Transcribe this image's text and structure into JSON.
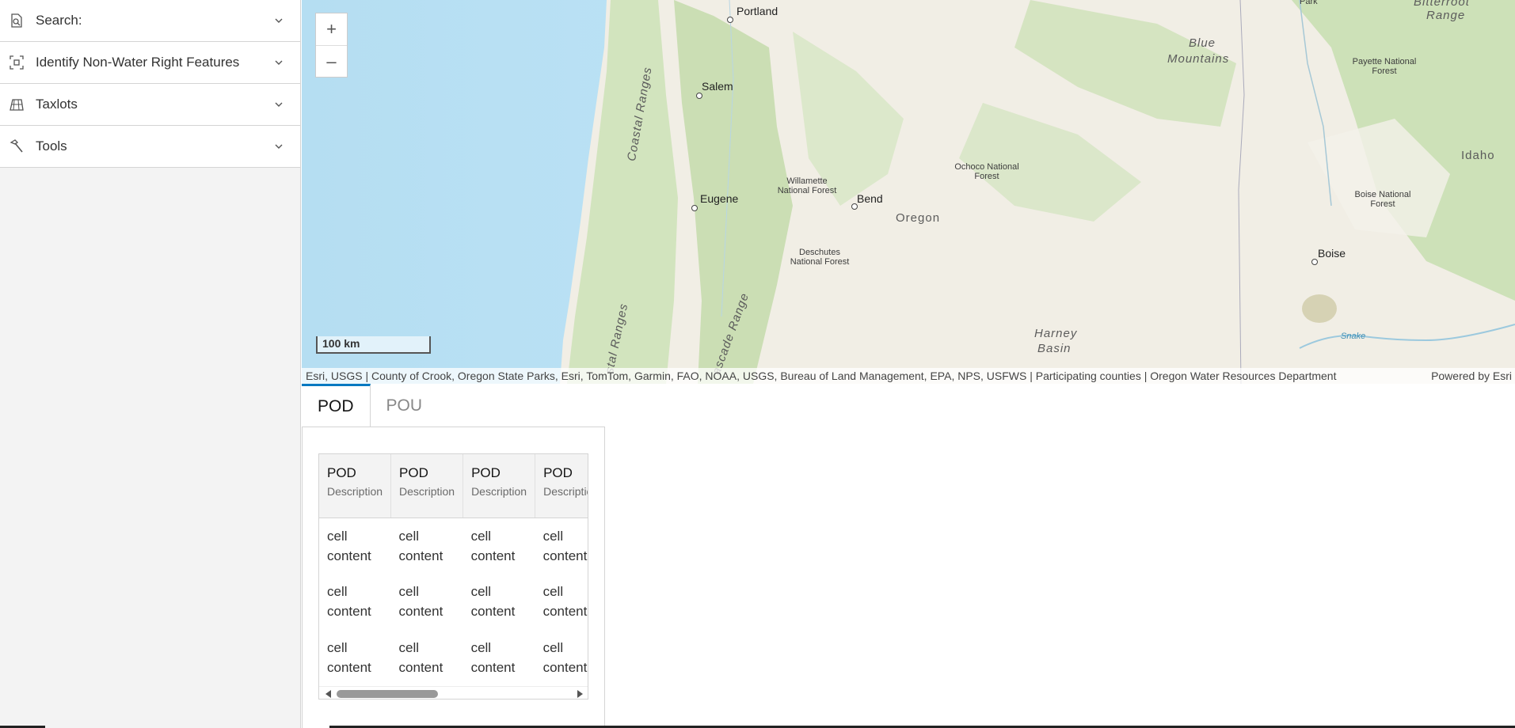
{
  "sidebar": {
    "items": [
      {
        "label": "Search:",
        "icon": "search-doc-icon"
      },
      {
        "label": "Identify Non-Water Right Features",
        "icon": "identify-select-icon"
      },
      {
        "label": "Taxlots",
        "icon": "taxlot-parcel-icon"
      },
      {
        "label": "Tools",
        "icon": "hammer-icon"
      }
    ]
  },
  "map": {
    "zoom_in": "+",
    "zoom_out": "–",
    "scale": "100 km",
    "labels": {
      "portland": "Portland",
      "salem": "Salem",
      "eugene": "Eugene",
      "bend": "Bend",
      "boise": "Boise",
      "oregon": "Oregon",
      "idaho": "Idaho",
      "coastal_ranges": "Coastal Ranges",
      "coastal_ranges_south": "stal Ranges",
      "cascade_range": "ascade Range",
      "blue_mountains_1": "Blue",
      "blue_mountains_2": "Mountains",
      "willamette_1": "Willamette",
      "willamette_2": "National Forest",
      "deschutes_1": "Deschutes",
      "deschutes_2": "National Forest",
      "ochoco_1": "Ochoco National",
      "ochoco_2": "Forest",
      "payette_1": "Payette National",
      "payette_2": "Forest",
      "boise_nf_1": "Boise National",
      "boise_nf_2": "Forest",
      "harney_1": "Harney",
      "harney_2": "Basin",
      "bitterroot_1": "Bitterroot",
      "bitterroot_2": "Range",
      "park": "Park",
      "snake": "Snake"
    },
    "attribution": "Esri, USGS | County of Crook, Oregon State Parks, Esri, TomTom, Garmin, FAO, NOAA, USGS, Bureau of Land Management, EPA, NPS, USFWS | Participating counties | Oregon Water Resources Department",
    "powered_by": "Powered by Esri",
    "widgets": [
      "legend-list-icon",
      "layers-icon",
      "basemap-gallery-icon",
      "measure-ruler-icon",
      "measure-area-icon",
      "print-icon"
    ],
    "active_widget": "measure-area-icon",
    "colors": {
      "water": "#bfe6f7",
      "land": "#f2efe6",
      "forest": "#cfe2bd",
      "accent": "#0079c1"
    }
  },
  "bottom": {
    "tabs": [
      {
        "label": "POD",
        "active": true
      },
      {
        "label": "POU",
        "active": false
      }
    ],
    "table": {
      "headers": [
        {
          "title": "POD",
          "sub": "Description"
        },
        {
          "title": "POD",
          "sub": "Description"
        },
        {
          "title": "POD",
          "sub": "Description"
        },
        {
          "title": "POD",
          "sub": "Description"
        }
      ],
      "rows": [
        [
          "cell content",
          "cell content",
          "cell content",
          "cell content"
        ],
        [
          "cell content",
          "cell content",
          "cell content",
          "cell content"
        ],
        [
          "cell content",
          "cell content",
          "cell content",
          "cell content"
        ]
      ]
    }
  }
}
